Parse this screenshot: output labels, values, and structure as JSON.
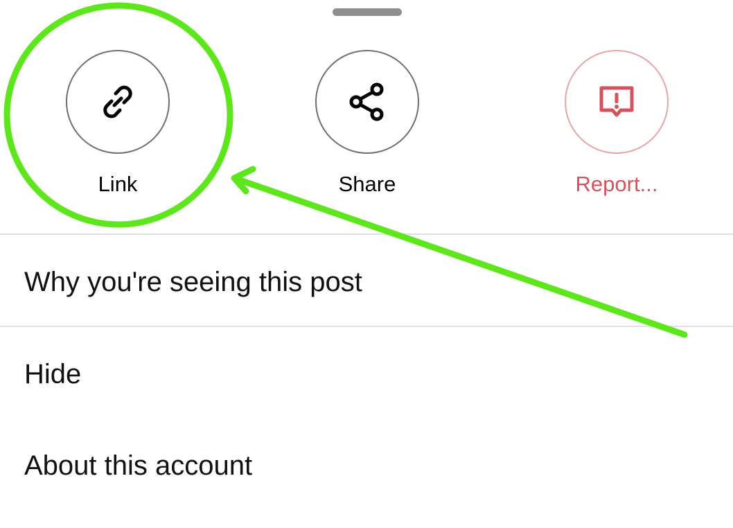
{
  "actions": [
    {
      "label": "Link",
      "icon": "link-icon"
    },
    {
      "label": "Share",
      "icon": "share-icon"
    },
    {
      "label": "Report...",
      "icon": "report-icon"
    }
  ],
  "menu": {
    "why": "Why you're seeing this post",
    "hide": "Hide",
    "about": "About this account"
  },
  "colors": {
    "report_accent": "#d5515e",
    "annotation_green": "#5ee61c"
  }
}
